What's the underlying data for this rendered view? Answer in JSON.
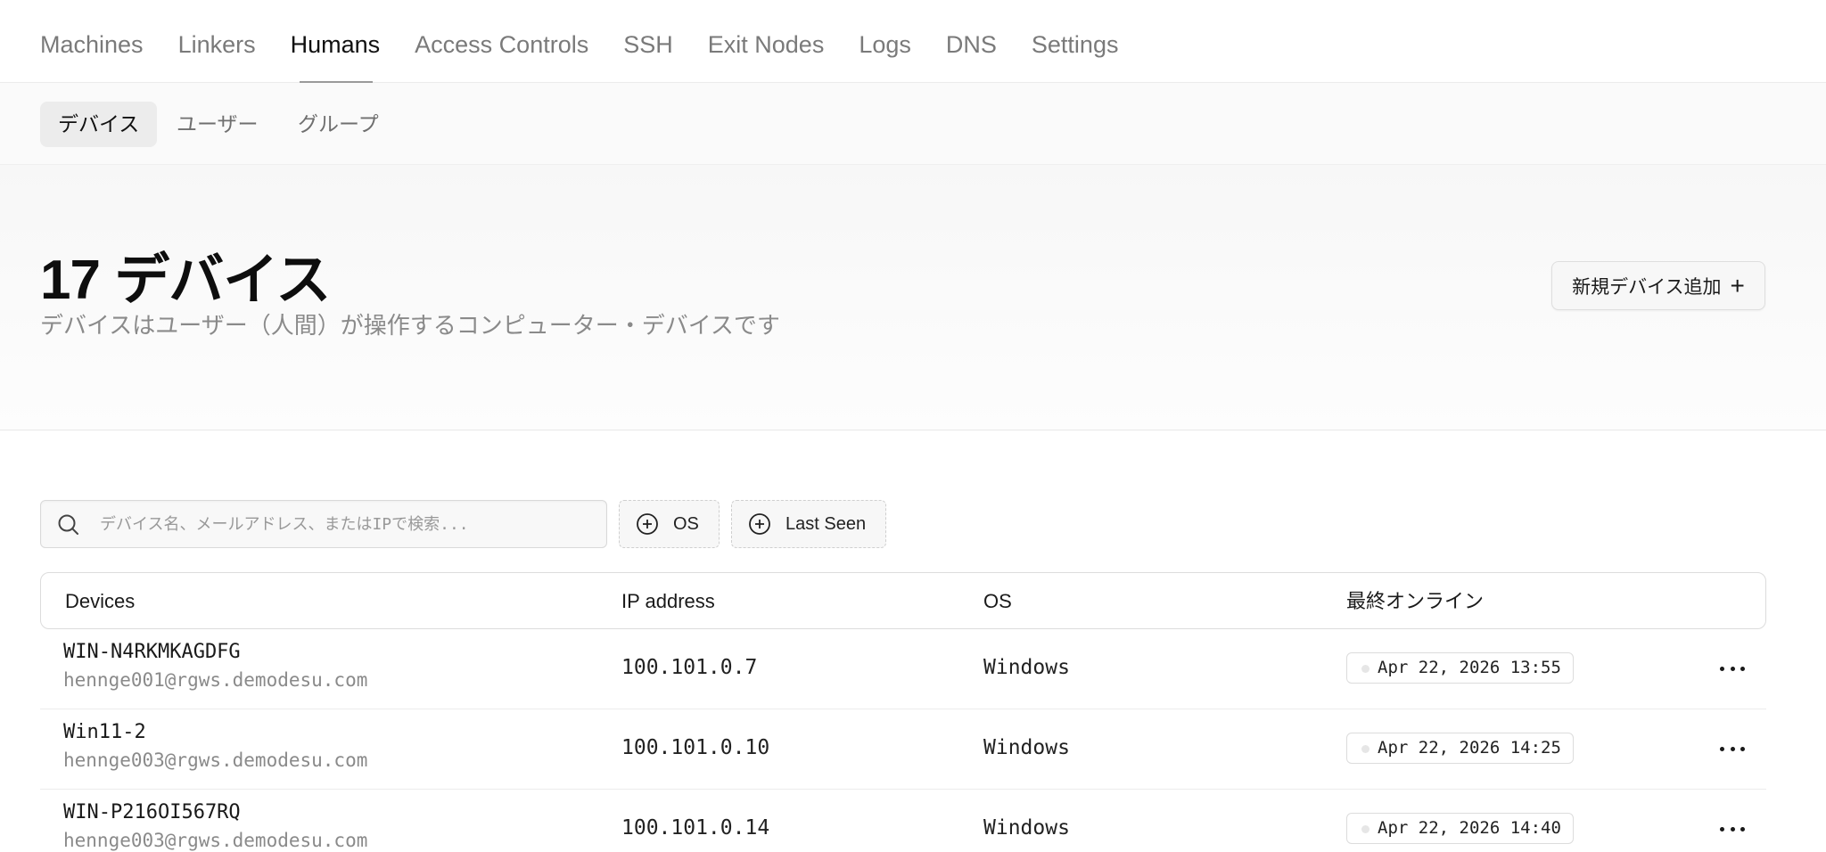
{
  "topnav": {
    "tabs": [
      "Machines",
      "Linkers",
      "Humans",
      "Access Controls",
      "SSH",
      "Exit Nodes",
      "Logs",
      "DNS",
      "Settings"
    ],
    "active": "Humans"
  },
  "subnav": {
    "items": [
      "デバイス",
      "ユーザー",
      "グループ"
    ],
    "active": "デバイス"
  },
  "header": {
    "title": "17 デバイス",
    "subtitle": "デバイスはユーザー（人間）が操作するコンピューター・デバイスです",
    "add_button": "新規デバイス追加"
  },
  "search": {
    "placeholder": "デバイス名、メールアドレス、またはIPで検索..."
  },
  "filters": [
    "OS",
    "Last Seen"
  ],
  "table": {
    "headers": [
      "Devices",
      "IP address",
      "OS",
      "最終オンライン"
    ],
    "rows": [
      {
        "name": "WIN-N4RKMKAGDFG",
        "email": "hennge001@rgws.demodesu.com",
        "ip": "100.101.0.7",
        "os": "Windows",
        "last_seen": "Apr 22, 2026 13:55"
      },
      {
        "name": "Win11-2",
        "email": "hennge003@rgws.demodesu.com",
        "ip": "100.101.0.10",
        "os": "Windows",
        "last_seen": "Apr 22, 2026 14:25"
      },
      {
        "name": "WIN-P216OI567RQ",
        "email": "hennge003@rgws.demodesu.com",
        "ip": "100.101.0.14",
        "os": "Windows",
        "last_seen": "Apr 22, 2026 14:40"
      }
    ]
  },
  "colors": {
    "text": "#1a1a1a",
    "muted": "#8a8a8a",
    "border": "#dcdcdc",
    "status_dot": "#e6e6e6"
  }
}
